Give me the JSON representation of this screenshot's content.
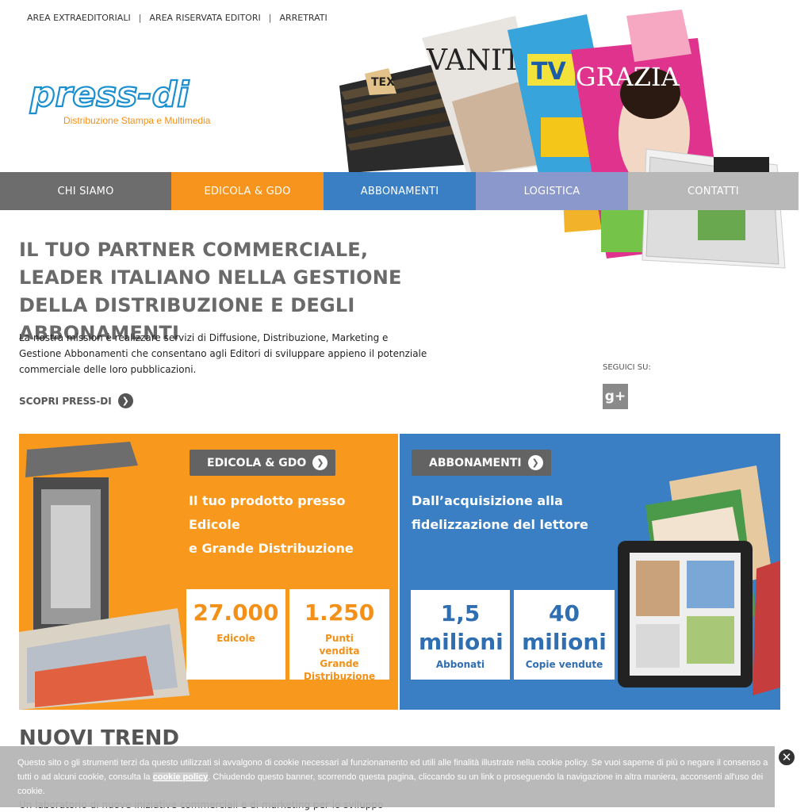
{
  "top_links": [
    "AREA EXTRAEDITORIALI",
    "AREA RISERVATA EDITORI",
    "ARRETRATI"
  ],
  "logo": {
    "name": "press-di",
    "tagline": "Distribuzione Stampa e Multimedia"
  },
  "nav": [
    {
      "label": "CHI SIAMO",
      "color": "#6d6d6d"
    },
    {
      "label": "EDICOLA & GDO",
      "color": "#f7941d"
    },
    {
      "label": "ABBONAMENTI",
      "color": "#3a7fc4"
    },
    {
      "label": "LOGISTICA",
      "color": "#8b98cc"
    },
    {
      "label": "CONTATTI",
      "color": "#b8b8b8"
    }
  ],
  "headline": "IL TUO PARTNER COMMERCIALE, LEADER ITALIANO NELLA GESTIONE DELLA DISTRIBUZIONE E DEGLI ABBONAMENTI",
  "mission": "La nostra mission è realizzare servizi di Diffusione, Distribuzione, Marketing e Gestione Abbonamenti che consentano agli Editori di sviluppare appieno il potenziale commerciale delle loro pubblicazioni.",
  "scopri": "SCOPRI PRESS-DI",
  "seguici": "SEGUICI SU:",
  "gplus": "g+",
  "edicola": {
    "button": "EDICOLA & GDO",
    "subtitle_1": "Il tuo prodotto presso Edicole",
    "subtitle_2": "e Grande Distribuzione",
    "stats": [
      {
        "num": "27.000",
        "label": "Edicole"
      },
      {
        "num": "1.250",
        "label": "Punti vendita Grande Distribuzione"
      }
    ]
  },
  "abbonamenti": {
    "button": "ABBONAMENTI",
    "subtitle_1": "Dall’acquisizione alla",
    "subtitle_2": "fidelizzazione del lettore",
    "stats": [
      {
        "num": "1,5 milioni",
        "label": "Abbonati"
      },
      {
        "num": "40 milioni",
        "label": "Copie vendute"
      }
    ]
  },
  "nuovi_trend": "NUOVI TREND",
  "nuovi_sub": "Un laboratorio di nuove iniziative commerciali e di marketing per lo sviluppo",
  "cookie": {
    "text_before": "Questo sito o gli strumenti terzi da questo utilizzati si avvalgono di cookie necessari al funzionamento ed utili alle finalità illustrate nella cookie policy. Se vuoi saperne di più o negare il consenso a tutti o ad alcuni cookie, consulta la ",
    "link": "cookie policy",
    "text_after": ". Chiudendo questo banner, scorrendo questa pagina, cliccando su un link o proseguendo la navigazione in altra maniera, acconsenti all'uso dei cookie."
  },
  "magazine_titles": [
    "TEX",
    "VANITY",
    "TV sorrisi e canzoni",
    "GRAZIA"
  ]
}
